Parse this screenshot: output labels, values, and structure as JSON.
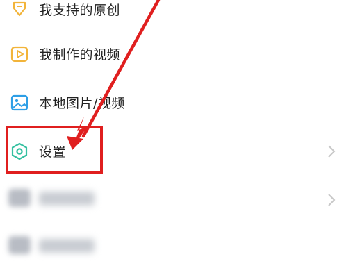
{
  "menu": {
    "items": [
      {
        "label": "我支持的原创",
        "icon": "heart-diamond-icon"
      },
      {
        "label": "我制作的视频",
        "icon": "video-play-icon"
      },
      {
        "label": "本地图片/视频",
        "icon": "image-icon"
      },
      {
        "label": "设置",
        "icon": "hexagon-gear-icon"
      }
    ]
  },
  "annotation": {
    "color": "#e01f1f"
  },
  "colors": {
    "icon_orange": "#f2b43a",
    "icon_blue": "#2e9fe6",
    "icon_teal": "#34c0a0",
    "text": "#222222",
    "chevron": "#c8c8c8"
  }
}
